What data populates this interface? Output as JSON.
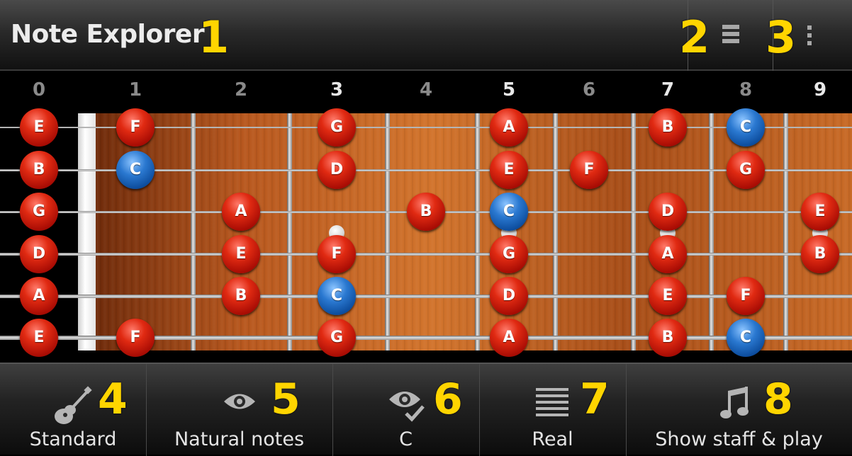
{
  "header": {
    "title": "Note Explorer",
    "annotation": "1"
  },
  "actions": [
    {
      "name": "list",
      "annotation": "2",
      "icon": "list-icon"
    },
    {
      "name": "overflow",
      "annotation": "3",
      "icon": "overflow-menu-icon"
    }
  ],
  "fret_numbers": [
    "0",
    "1",
    "2",
    "3",
    "4",
    "5",
    "6",
    "7",
    "8",
    "9"
  ],
  "strings": [
    "E",
    "B",
    "G",
    "D",
    "A",
    "E"
  ],
  "notes": [
    {
      "string": 0,
      "fret": 0,
      "label": "E",
      "color": "red"
    },
    {
      "string": 0,
      "fret": 1,
      "label": "F",
      "color": "red"
    },
    {
      "string": 0,
      "fret": 3,
      "label": "G",
      "color": "red"
    },
    {
      "string": 0,
      "fret": 5,
      "label": "A",
      "color": "red"
    },
    {
      "string": 0,
      "fret": 7,
      "label": "B",
      "color": "red"
    },
    {
      "string": 0,
      "fret": 8,
      "label": "C",
      "color": "blue"
    },
    {
      "string": 1,
      "fret": 0,
      "label": "B",
      "color": "red"
    },
    {
      "string": 1,
      "fret": 1,
      "label": "C",
      "color": "blue"
    },
    {
      "string": 1,
      "fret": 3,
      "label": "D",
      "color": "red"
    },
    {
      "string": 1,
      "fret": 5,
      "label": "E",
      "color": "red"
    },
    {
      "string": 1,
      "fret": 6,
      "label": "F",
      "color": "red"
    },
    {
      "string": 1,
      "fret": 8,
      "label": "G",
      "color": "red"
    },
    {
      "string": 2,
      "fret": 0,
      "label": "G",
      "color": "red"
    },
    {
      "string": 2,
      "fret": 2,
      "label": "A",
      "color": "red"
    },
    {
      "string": 2,
      "fret": 4,
      "label": "B",
      "color": "red"
    },
    {
      "string": 2,
      "fret": 5,
      "label": "C",
      "color": "blue"
    },
    {
      "string": 2,
      "fret": 7,
      "label": "D",
      "color": "red"
    },
    {
      "string": 2,
      "fret": 9,
      "label": "E",
      "color": "red"
    },
    {
      "string": 3,
      "fret": 0,
      "label": "D",
      "color": "red"
    },
    {
      "string": 3,
      "fret": 2,
      "label": "E",
      "color": "red"
    },
    {
      "string": 3,
      "fret": 3,
      "label": "F",
      "color": "red"
    },
    {
      "string": 3,
      "fret": 5,
      "label": "G",
      "color": "red"
    },
    {
      "string": 3,
      "fret": 7,
      "label": "A",
      "color": "red"
    },
    {
      "string": 3,
      "fret": 9,
      "label": "B",
      "color": "red"
    },
    {
      "string": 4,
      "fret": 0,
      "label": "A",
      "color": "red"
    },
    {
      "string": 4,
      "fret": 2,
      "label": "B",
      "color": "red"
    },
    {
      "string": 4,
      "fret": 3,
      "label": "C",
      "color": "blue"
    },
    {
      "string": 4,
      "fret": 5,
      "label": "D",
      "color": "red"
    },
    {
      "string": 4,
      "fret": 7,
      "label": "E",
      "color": "red"
    },
    {
      "string": 4,
      "fret": 8,
      "label": "F",
      "color": "red"
    },
    {
      "string": 5,
      "fret": 0,
      "label": "E",
      "color": "red"
    },
    {
      "string": 5,
      "fret": 1,
      "label": "F",
      "color": "red"
    },
    {
      "string": 5,
      "fret": 3,
      "label": "G",
      "color": "red"
    },
    {
      "string": 5,
      "fret": 5,
      "label": "A",
      "color": "red"
    },
    {
      "string": 5,
      "fret": 7,
      "label": "B",
      "color": "red"
    },
    {
      "string": 5,
      "fret": 8,
      "label": "C",
      "color": "blue"
    }
  ],
  "inlay_frets": [
    3,
    5,
    7,
    9
  ],
  "toolbar": [
    {
      "label": "Standard",
      "annotation": "4",
      "icon": "guitar-icon"
    },
    {
      "label": "Natural notes",
      "annotation": "5",
      "icon": "eye-icon"
    },
    {
      "label": "C",
      "annotation": "6",
      "icon": "eye-check-icon"
    },
    {
      "label": "Real",
      "annotation": "7",
      "icon": "lines-icon"
    },
    {
      "label": "Show staff & play",
      "annotation": "8",
      "icon": "music-note-icon"
    }
  ],
  "colors": {
    "annotation": "#ffd500",
    "note_red": "#d42010",
    "note_blue": "#1f6cc4"
  }
}
